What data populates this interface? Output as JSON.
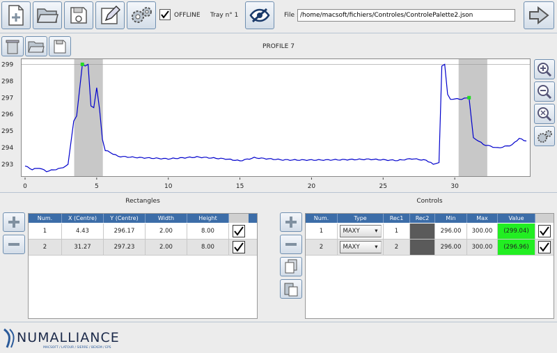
{
  "toolbar": {
    "offline_label": "OFFLINE",
    "offline_checked": true,
    "tray_label": "Tray n° 1",
    "file_label": "File :",
    "file_path": "/home/macsoft/fichiers/Controles/ControlePalette2.json",
    "icons": [
      "new-file-icon",
      "open-folder-icon",
      "save-disk-icon",
      "edit-save-icon",
      "settings-gears-icon",
      "hide-eye-icon",
      "exit-arrow-icon"
    ]
  },
  "profile": {
    "title": "PROFILE 7"
  },
  "chart_data": {
    "type": "line",
    "title": "PROFILE 7",
    "xlabel": "",
    "ylabel": "",
    "xlim": [
      0,
      35
    ],
    "ylim": [
      292.5,
      299.1
    ],
    "x_ticks": [
      "0",
      "5",
      "10",
      "15",
      "20",
      "25",
      "30"
    ],
    "y_ticks": [
      "293",
      "294",
      "295",
      "296",
      "297",
      "298",
      "299"
    ],
    "grid": false,
    "series": [
      {
        "color": "#0000cc",
        "x": [
          0,
          0.5,
          1,
          1.5,
          2,
          2.5,
          3,
          3.4,
          3.6,
          4.0,
          4.2,
          4.4,
          4.6,
          4.8,
          5.0,
          5.2,
          5.4,
          5.6,
          6.5,
          8,
          10,
          12,
          14,
          15,
          16,
          18,
          20,
          22,
          24,
          26,
          27,
          28,
          28.5,
          28.9,
          29.1,
          29.3,
          29.5,
          29.7,
          30,
          30.5,
          31,
          31.3,
          31.5,
          32,
          33,
          34,
          34.5,
          35
        ],
        "y": [
          292.9,
          292.7,
          292.8,
          292.6,
          292.7,
          292.8,
          293.0,
          295.6,
          295.9,
          299.0,
          298.9,
          299.0,
          296.5,
          296.4,
          297.6,
          296.3,
          294.5,
          293.8,
          293.5,
          293.4,
          293.3,
          293.4,
          293.3,
          293.2,
          293.4,
          293.3,
          293.3,
          293.3,
          293.3,
          293.2,
          293.3,
          293.2,
          293.0,
          293.1,
          298.9,
          299.0,
          297.2,
          296.9,
          296.9,
          296.9,
          297.0,
          294.6,
          294.5,
          294.2,
          294.0,
          294.2,
          294.6,
          294.4
        ]
      }
    ],
    "rectangles": [
      {
        "x_center": 4.43,
        "y_center": 296.17,
        "width": 2.0,
        "height": 8.0
      },
      {
        "x_center": 31.27,
        "y_center": 297.23,
        "width": 2.0,
        "height": 8.0
      }
    ],
    "markers": [
      {
        "x": 4.0,
        "y": 299.0
      },
      {
        "x": 31.0,
        "y": 297.0
      }
    ]
  },
  "rectangles": {
    "title": "Rectangles",
    "columns": [
      "Num.",
      "X (Centre)",
      "Y (Centre)",
      "Width",
      "Height"
    ],
    "rows": [
      {
        "num": "1",
        "x": "4.43",
        "y": "296.17",
        "w": "2.00",
        "h": "8.00"
      },
      {
        "num": "2",
        "x": "31.27",
        "y": "297.23",
        "w": "2.00",
        "h": "8.00"
      }
    ]
  },
  "controls": {
    "title": "Controls",
    "columns": [
      "Num.",
      "Type",
      "Rec1",
      "Rec2",
      "Min",
      "Max",
      "Value"
    ],
    "rows": [
      {
        "num": "1",
        "type": "MAXY",
        "rec1": "1",
        "rec2": "",
        "min": "296.00",
        "max": "300.00",
        "value": "(299.04)"
      },
      {
        "num": "2",
        "type": "MAXY",
        "rec1": "2",
        "rec2": "",
        "min": "296.00",
        "max": "300.00",
        "value": "(296.96)"
      }
    ]
  },
  "footer": {
    "brand": "NUMALLIANCE",
    "tagline": "MACSOFT / LATOUR / SIERRE / BEXEM / EPS"
  },
  "colors": {
    "accent": "#3c6da8",
    "curve": "#0000cc",
    "ok": "#22ee22",
    "rect": "#c8c8c8"
  }
}
